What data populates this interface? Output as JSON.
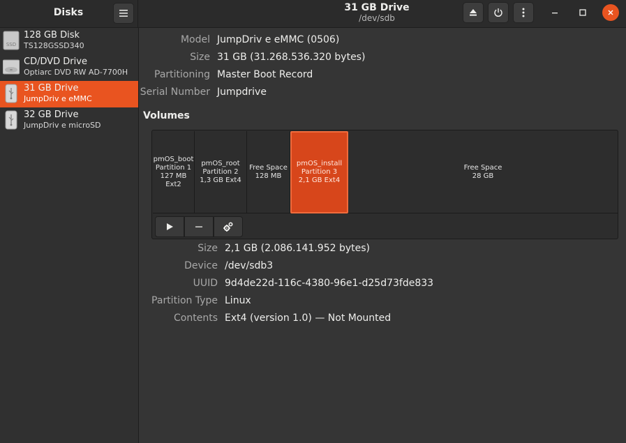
{
  "sidebar": {
    "title": "Disks",
    "disks": [
      {
        "name": "128 GB Disk",
        "model": "TS128GSSD340",
        "icon": "ssd-icon",
        "badge": "SSD"
      },
      {
        "name": "CD/DVD Drive",
        "model": "Optiarc DVD RW AD-7700H",
        "icon": "optical-drive-icon"
      },
      {
        "name": "31 GB Drive",
        "model": "JumpDriv e eMMC",
        "icon": "usb-drive-icon",
        "active": true
      },
      {
        "name": "32 GB Drive",
        "model": "JumpDriv e microSD",
        "icon": "usb-drive-icon"
      }
    ]
  },
  "header": {
    "title": "31 GB Drive",
    "subtitle": "/dev/sdb"
  },
  "drive": {
    "model_label": "Model",
    "model": "JumpDriv e eMMC (0506)",
    "size_label": "Size",
    "size": "31 GB (31.268.536.320 bytes)",
    "partitioning_label": "Partitioning",
    "partitioning": "Master Boot Record",
    "serial_label": "Serial Number",
    "serial": "Jumpdrive"
  },
  "volumes": {
    "title": "Volumes",
    "items": [
      {
        "line1": "pmOS_boot",
        "line2": "Partition 1",
        "line3": "127 MB Ext2"
      },
      {
        "line1": "pmOS_root",
        "line2": "Partition 2",
        "line3": "1,3 GB Ext4"
      },
      {
        "line1": "Free Space",
        "line2": "128 MB",
        "line3": ""
      },
      {
        "line1": "pmOS_install",
        "line2": "Partition 3",
        "line3": "2,1 GB Ext4",
        "selected": true
      },
      {
        "line1": "Free Space",
        "line2": "28 GB",
        "line3": ""
      }
    ]
  },
  "partition": {
    "size_label": "Size",
    "size": "2,1 GB (2.086.141.952 bytes)",
    "device_label": "Device",
    "device": "/dev/sdb3",
    "uuid_label": "UUID",
    "uuid": "9d4de22d-116c-4380-96e1-d25d73fde833",
    "type_label": "Partition Type",
    "type": "Linux",
    "contents_label": "Contents",
    "contents": "Ext4 (version 1.0) — Not Mounted"
  },
  "colors": {
    "accent": "#e95420",
    "selected_partition": "#d7461b"
  }
}
